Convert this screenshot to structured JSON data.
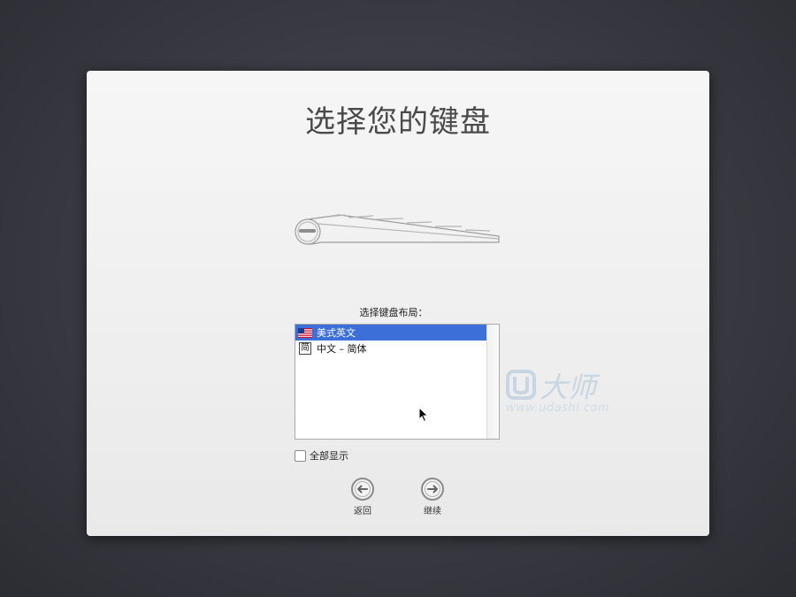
{
  "window": {
    "title": "选择您的键盘"
  },
  "keyboard_layout": {
    "label": "选择键盘布局：",
    "items": [
      {
        "label": "美式英文",
        "icon": "us-flag-icon",
        "selected": true
      },
      {
        "label": "中文 – 简体",
        "icon": "simplified-chinese-icon",
        "icon_glyph": "简",
        "selected": false
      }
    ]
  },
  "show_all": {
    "label": "全部显示",
    "checked": false
  },
  "nav": {
    "back_label": "返回",
    "continue_label": "继续"
  },
  "watermark": {
    "brand": "U大师",
    "url": "www.udashi.com"
  },
  "colors": {
    "selection": "#3d6fd9",
    "panel": "#efefef",
    "background": "#393a41"
  }
}
